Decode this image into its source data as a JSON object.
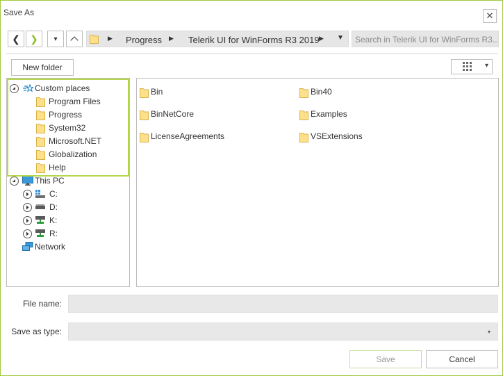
{
  "window": {
    "title": "Save As",
    "close_glyph": "✕"
  },
  "nav": {
    "back_glyph": "❮",
    "forward_glyph": "❯",
    "dropdown_glyph": "▾",
    "up_glyph": "︿"
  },
  "breadcrumb": {
    "separator_glyph": "▶",
    "items": [
      "Progress",
      "Telerik UI for WinForms R3 2019"
    ],
    "dropdown_glyph": "▼"
  },
  "search": {
    "placeholder": "Search in Telerik UI for WinForms R3..."
  },
  "toolbar": {
    "new_folder_label": "New folder",
    "view_dropdown_glyph": "▾"
  },
  "tree": {
    "custom_places": {
      "label": "Custom places",
      "items": [
        "Program Files",
        "Progress",
        "System32",
        "Microsoft.NET",
        "Globalization",
        "Help"
      ]
    },
    "this_pc": {
      "label": "This PC",
      "drives": [
        "C:",
        "D:",
        "K:",
        "R:"
      ]
    },
    "network": {
      "label": "Network"
    }
  },
  "files": {
    "col1": [
      "Bin",
      "BinNetCore",
      "LicenseAgreements"
    ],
    "col2": [
      "Bin40",
      "Examples",
      "VSExtensions"
    ]
  },
  "form": {
    "file_name_label": "File name:",
    "file_name_value": "",
    "save_as_type_label": "Save as type:",
    "save_as_type_value": "",
    "combo_arrow_glyph": "▾"
  },
  "buttons": {
    "save_label": "Save",
    "cancel_label": "Cancel"
  },
  "colors": {
    "accent_border": "#9fc93c",
    "highlight": "#b5d84a",
    "folder": "#ffe08a"
  }
}
